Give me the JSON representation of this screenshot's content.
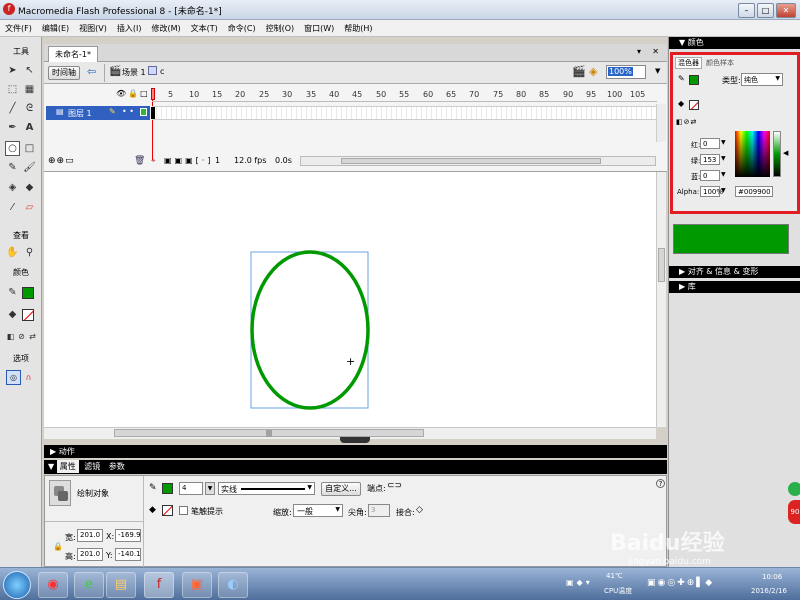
{
  "window": {
    "title": "Macromedia Flash Professional 8 - [未命名-1*]",
    "min": "–",
    "max": "□",
    "close": "✕"
  },
  "menu": [
    "文件(F)",
    "编辑(E)",
    "视图(V)",
    "插入(I)",
    "修改(M)",
    "文本(T)",
    "命令(C)",
    "控制(O)",
    "窗口(W)",
    "帮助(H)"
  ],
  "toolbox": {
    "tools_title": "工具",
    "view_title": "查看",
    "color_title": "颜色",
    "options_title": "选项"
  },
  "document": {
    "tab": "未命名-1*",
    "timeline_button": "时间轴",
    "scene": "场景 1",
    "symbol": "c",
    "zoom": "100%"
  },
  "timeline": {
    "layer_name": "图层 1",
    "ruler": [
      "5",
      "10",
      "15",
      "20",
      "25",
      "30",
      "35",
      "40",
      "45",
      "50",
      "55",
      "60",
      "65",
      "70",
      "75",
      "80",
      "85",
      "90",
      "95",
      "100",
      "105"
    ],
    "frame": "1",
    "fps": "12.0 fps",
    "time": "0.0s"
  },
  "stage": {
    "circle_color": "#009900"
  },
  "panels": {
    "actions": "动作"
  },
  "properties": {
    "tabs": [
      "属性",
      "滤镜",
      "参数"
    ],
    "object_type": "绘制对象",
    "stroke_height": "4",
    "stroke_style": "实线",
    "custom_button": "自定义...",
    "cap_label": "端点:",
    "hinting_label": "笔触提示",
    "scale_label": "缩放:",
    "scale_value": "一般",
    "miter_label": "尖角:",
    "miter_value": "3",
    "join_label": "接合:",
    "width_label": "宽:",
    "width_value": "201.0",
    "height_label": "高:",
    "height_value": "201.0",
    "x_label": "X:",
    "x_value": "-169.9",
    "y_label": "Y:",
    "y_value": "-140.1"
  },
  "color_panel": {
    "title": "颜色",
    "tab_mixer": "混色器",
    "tab_swatches": "颜色样本",
    "type_label": "类型:",
    "type_value": "纯色",
    "r_label": "红:",
    "r_value": "0",
    "g_label": "绿:",
    "g_value": "153",
    "b_label": "蓝:",
    "b_value": "0",
    "alpha_label": "Alpha:",
    "alpha_value": "100%",
    "hex": "#009900",
    "swatch_color": "#009900"
  },
  "right_panels": {
    "align": "对齐 & 信息 & 变形",
    "library": "库"
  },
  "watermark": {
    "brand": "Baidu经验",
    "url": "jingyan.baidu.com"
  },
  "taskbar": {
    "time": "10:06",
    "date": "2016/2/16",
    "cpu_label": "CPU温度",
    "temp": "41℃"
  },
  "colors": {
    "accent": "#009900",
    "highlight_border": "#e31b23"
  }
}
